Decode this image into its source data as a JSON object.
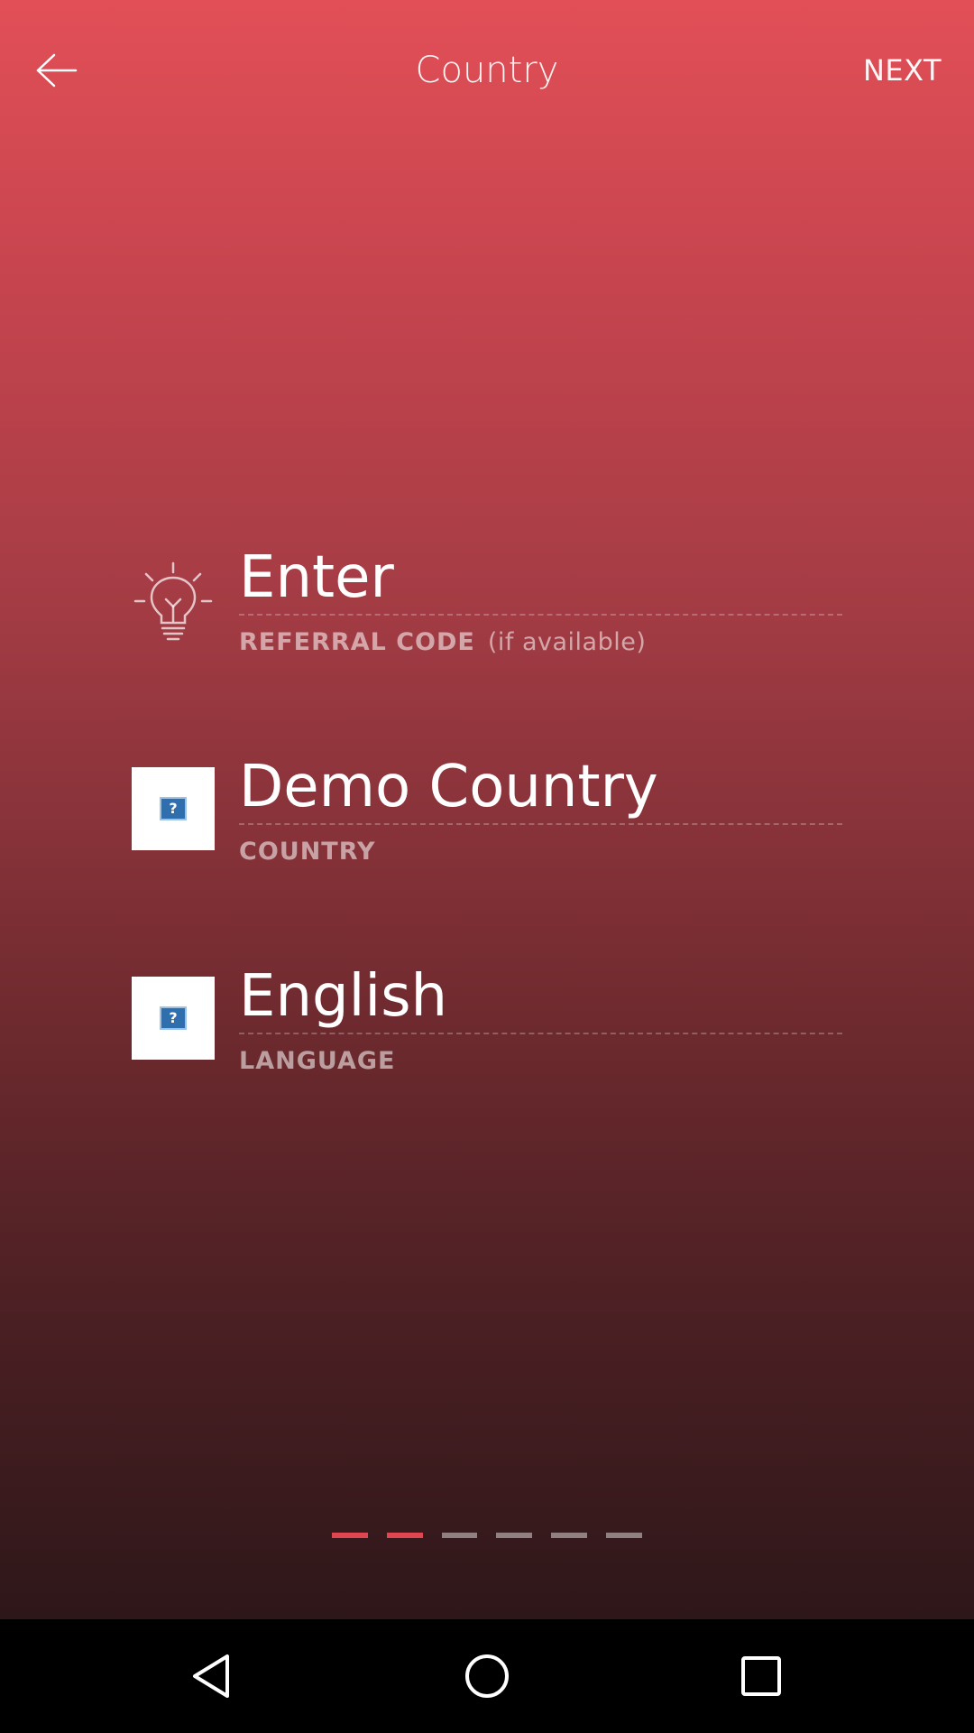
{
  "header": {
    "title": "Country",
    "next_label": "NEXT",
    "back_icon": "arrow-left-icon"
  },
  "referral": {
    "value": "Enter",
    "label": "REFERRAL CODE",
    "hint": "(if available)",
    "icon": "lightbulb-icon"
  },
  "country": {
    "value": "Demo Country",
    "label": "COUNTRY",
    "icon": "flag-placeholder-icon"
  },
  "language": {
    "value": "English",
    "label": "LANGUAGE",
    "icon": "flag-placeholder-icon"
  },
  "pager": {
    "total_steps": 6,
    "completed_steps": 2
  },
  "colors": {
    "accent": "#e0464f",
    "gradient_top": "#e24f57",
    "gradient_bottom": "#2e1719",
    "text": "#ffffff"
  },
  "navbar": {
    "back_icon": "nav-back-triangle-icon",
    "home_icon": "nav-home-circle-icon",
    "recents_icon": "nav-recents-square-icon"
  }
}
